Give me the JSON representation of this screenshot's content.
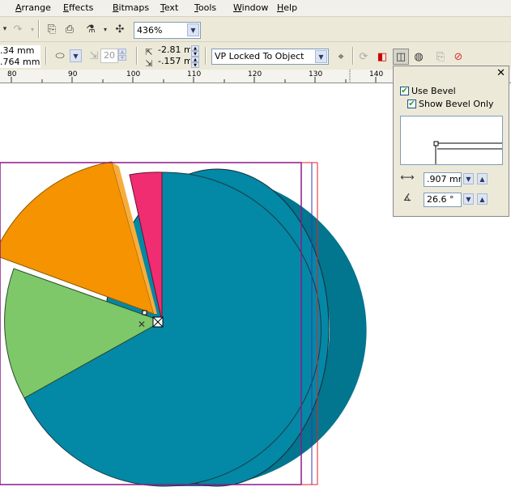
{
  "menu": {
    "items": [
      "Arrange",
      "Effects",
      "Bitmaps",
      "Text",
      "Tools",
      "Window",
      "Help"
    ]
  },
  "toolbar1": {
    "zoom_value": "436%",
    "icons": [
      "undo-icon",
      "redo-icon",
      "import-icon",
      "export-icon",
      "publish-icon",
      "dropdown-icon",
      "app-launcher-icon"
    ]
  },
  "toolbar2": {
    "pos_x": ".34 mm",
    "pos_y": ".764 mm",
    "depth_value": "20",
    "offset_x": "-2.81 mr",
    "offset_y": "-.157 mr",
    "vanishing_point": "VP Locked To Object"
  },
  "ruler": {
    "labels": [
      "80",
      "90",
      "100",
      "110",
      "120",
      "130",
      "140"
    ]
  },
  "bevel_panel": {
    "use_bevel_label": "Use Bevel",
    "use_bevel_checked": true,
    "show_bevel_only_label": "Show Bevel Only",
    "show_bevel_only_checked": true,
    "depth_value": ".907 mm",
    "angle_value": "26.6 °",
    "close_glyph": "✕"
  },
  "colors": {
    "teal": "#0388a6",
    "orange": "#f59300",
    "green": "#7ec86a",
    "pink": "#f02d71",
    "selection_purple": "#8a1a8a",
    "selection_red": "#e8202a"
  }
}
